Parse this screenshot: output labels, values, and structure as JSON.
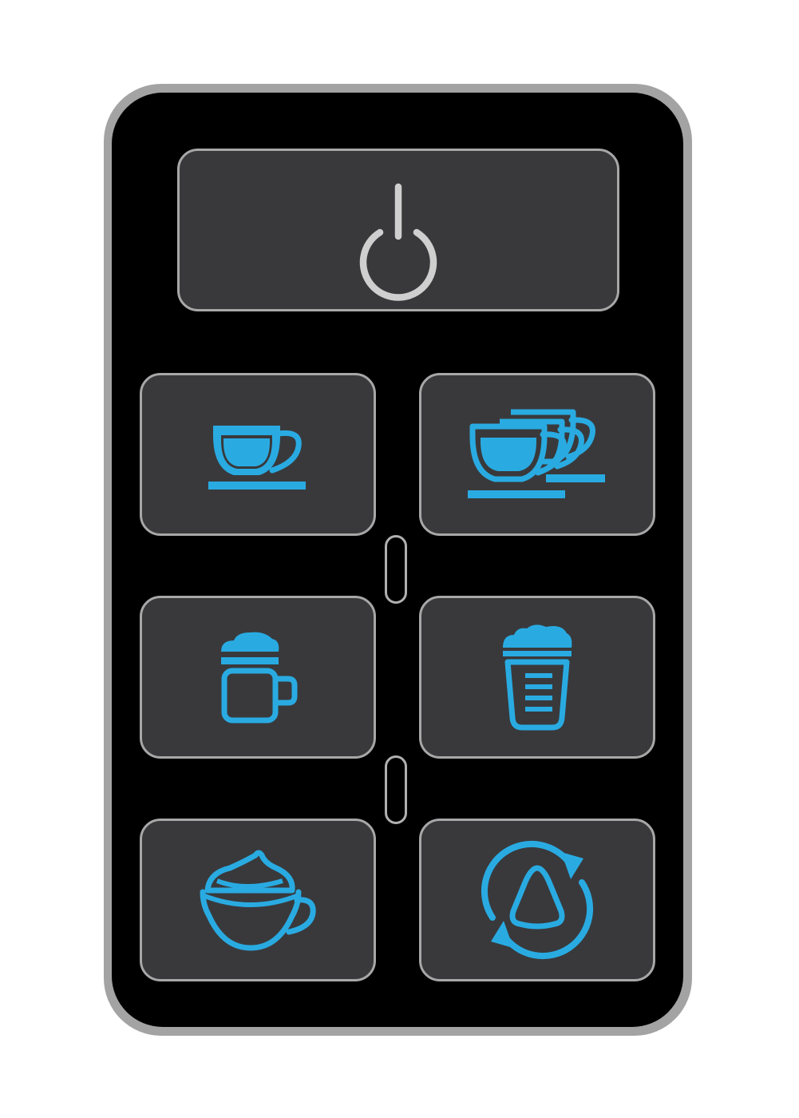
{
  "panel": {
    "buttons": [
      {
        "id": "power",
        "icon": "power-icon",
        "icon_color": "#cfcfcf"
      },
      {
        "id": "single-espresso",
        "icon": "single-cup-icon",
        "icon_color": "#29abe2"
      },
      {
        "id": "double-espresso",
        "icon": "double-cup-icon",
        "icon_color": "#29abe2"
      },
      {
        "id": "milk-mug",
        "icon": "foamed-mug-icon",
        "icon_color": "#29abe2"
      },
      {
        "id": "milk-glass",
        "icon": "foamed-glass-icon",
        "icon_color": "#29abe2"
      },
      {
        "id": "cappuccino",
        "icon": "cappuccino-cup-icon",
        "icon_color": "#29abe2"
      },
      {
        "id": "rinse",
        "icon": "rinse-cycle-icon",
        "icon_color": "#29abe2"
      }
    ],
    "indicators": [
      {
        "id": "indicator-upper",
        "state": "off"
      },
      {
        "id": "indicator-lower",
        "state": "off"
      }
    ],
    "colors": {
      "panel": "#000000",
      "bezel": "#a3a3a3",
      "button_face": "#39393c",
      "button_border": "#a7a7a7",
      "accent": "#29abe2"
    }
  }
}
